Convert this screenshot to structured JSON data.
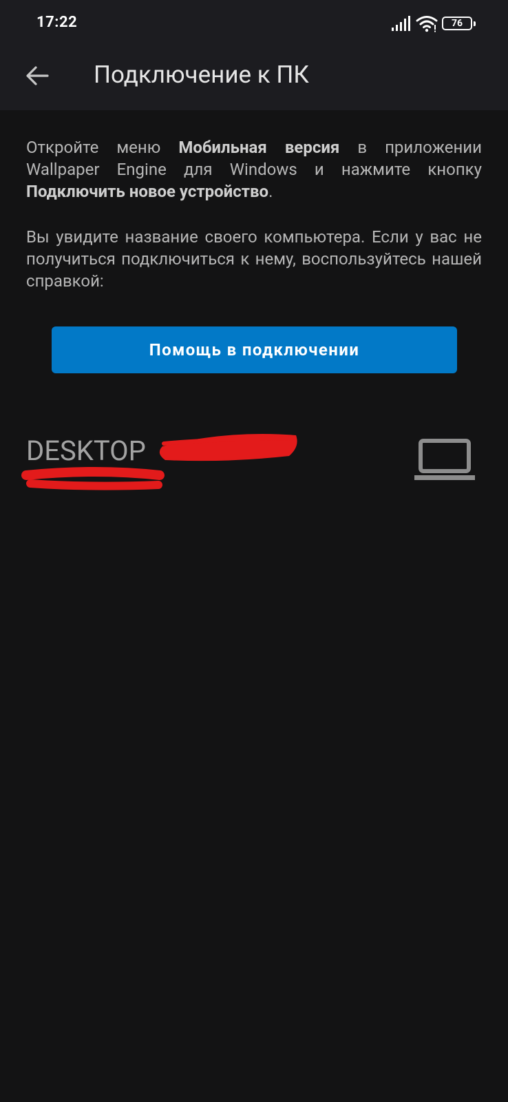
{
  "status_bar": {
    "time": "17:22",
    "battery_level": "76",
    "icons": [
      "signal-icon",
      "wifi-icon",
      "battery-icon"
    ]
  },
  "app_bar": {
    "back_icon": "arrow-left-icon",
    "title": "Подключение к ПК"
  },
  "instructions": {
    "p1_part1": "Откройте меню ",
    "p1_bold1": "Мобильная версия",
    "p1_part2": " в приложении Wallpaper Engine для Windows и нажмите кнопку ",
    "p1_bold2": "Подключить новое устройство",
    "p1_part3": ".",
    "p2": "Вы увидите название своего компьютера. Если у вас не получиться подключиться к нему, воспользуйтесь нашей справкой:"
  },
  "help_button": {
    "label": "Помощь в подключении"
  },
  "devices": [
    {
      "name": "DESKTOP",
      "icon": "laptop-icon",
      "redaction_color": "#e31b1b"
    }
  ],
  "colors": {
    "background": "#131314",
    "bar_background": "#1c1c20",
    "accent": "#0279c7",
    "redaction": "#e31b1b"
  }
}
